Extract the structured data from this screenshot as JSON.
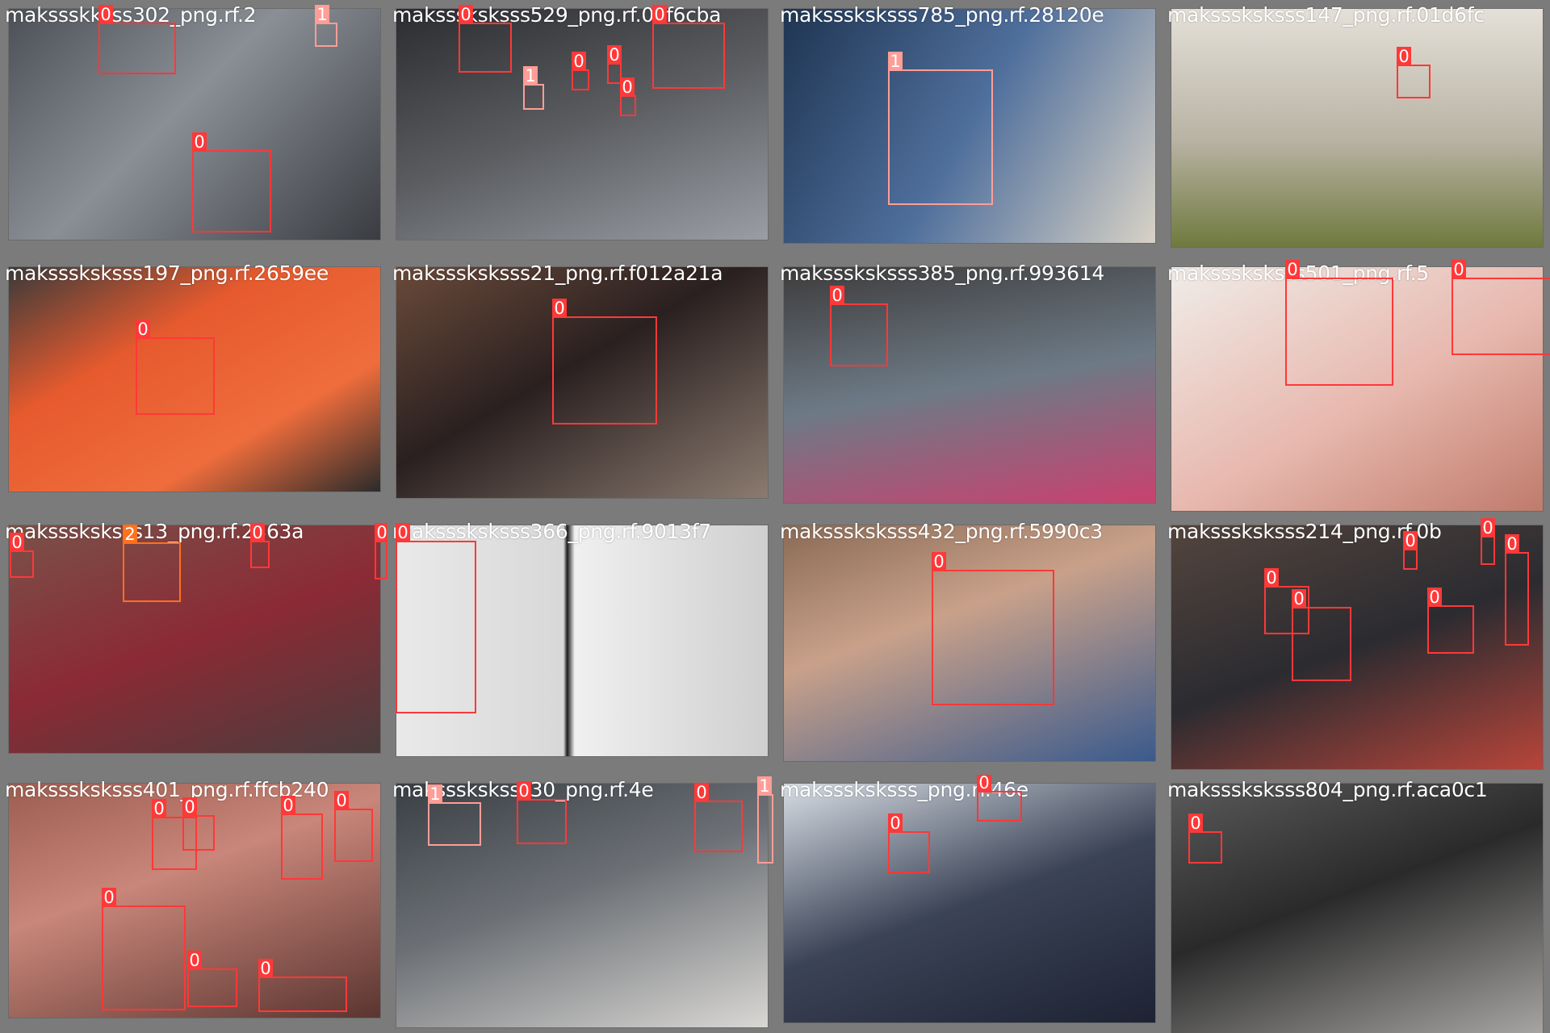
{
  "palette": {
    "class_0": "#ff3838",
    "class_1": "#ff9d97",
    "class_2": "#ff701f"
  },
  "tiles": [
    {
      "title": "makssskksss302_png.rf.2",
      "detections": [
        {
          "cls": "0"
        },
        {
          "cls": "1"
        },
        {
          "cls": "0"
        }
      ]
    },
    {
      "title": "maksssksksss529_png.rf.0af6cba",
      "detections": [
        {
          "cls": "0"
        },
        {
          "cls": "0"
        },
        {
          "cls": "1"
        },
        {
          "cls": "0"
        },
        {
          "cls": "0"
        },
        {
          "cls": "0"
        }
      ]
    },
    {
      "title": "maksssksksss785_png.rf.28120e",
      "detections": [
        {
          "cls": "1"
        }
      ]
    },
    {
      "title": "maksssksksss147_png.rf.01d6fc",
      "detections": [
        {
          "cls": "0"
        }
      ]
    },
    {
      "title": "maksssksksss197_png.rf.2659ee",
      "detections": [
        {
          "cls": "0"
        }
      ]
    },
    {
      "title": "maksssksksss21_png.rf.f012a21a",
      "detections": [
        {
          "cls": "0"
        }
      ]
    },
    {
      "title": "maksssksksss385_png.rf.993614",
      "detections": [
        {
          "cls": "0"
        }
      ]
    },
    {
      "title": "maksssksksss501_png.rf.5",
      "detections": [
        {
          "cls": "0"
        },
        {
          "cls": "0"
        }
      ]
    },
    {
      "title": "maksssksksss13_png.rf.2363a",
      "detections": [
        {
          "cls": "0"
        },
        {
          "cls": "2"
        },
        {
          "cls": "0"
        },
        {
          "cls": "0"
        }
      ]
    },
    {
      "title": "maksssksksss366_png.rf.9013f7",
      "detections": [
        {
          "cls": "0"
        }
      ]
    },
    {
      "title": "maksssksksss432_png.rf.5990c3",
      "detections": [
        {
          "cls": "0"
        }
      ]
    },
    {
      "title": "maksssksksss214_png.rf.0b",
      "detections": [
        {
          "cls": "0"
        },
        {
          "cls": "0"
        },
        {
          "cls": "0"
        },
        {
          "cls": "0"
        },
        {
          "cls": "0"
        },
        {
          "cls": "0"
        }
      ]
    },
    {
      "title": "maksssksksss401_png.rf.ffcb240",
      "detections": [
        {
          "cls": "0"
        },
        {
          "cls": "0"
        },
        {
          "cls": "0"
        },
        {
          "cls": "0"
        },
        {
          "cls": "0"
        },
        {
          "cls": "0"
        },
        {
          "cls": "0"
        }
      ]
    },
    {
      "title": "maksssksksss30_png.rf.4e",
      "detections": [
        {
          "cls": "1"
        },
        {
          "cls": "0"
        },
        {
          "cls": "0"
        },
        {
          "cls": "1"
        }
      ]
    },
    {
      "title": "maksssksksss_png.rf.46e",
      "detections": [
        {
          "cls": "0"
        },
        {
          "cls": "0"
        }
      ]
    },
    {
      "title": "maksssksksss804_png.rf.aca0c1",
      "detections": [
        {
          "cls": "0"
        }
      ]
    }
  ]
}
